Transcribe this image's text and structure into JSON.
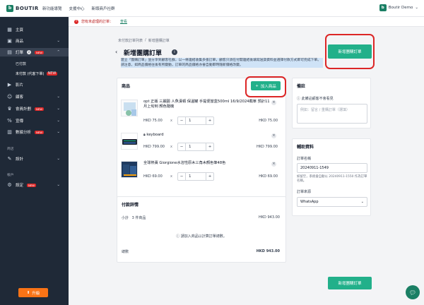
{
  "brand": {
    "name": "BOUTIR",
    "accent": "#22b08a",
    "dark": "#1f2937",
    "alert": "#dc2626"
  },
  "topnav": [
    "新功能導覽",
    "支援中心",
    "新頭商戶社群"
  ],
  "user": {
    "store": "Boutir Demo",
    "chevron": "chevron-down-icon"
  },
  "banner": {
    "message": "您有未處理的訂單：",
    "link": "查看"
  },
  "sidebar": {
    "items": [
      {
        "label": "主頁",
        "icon": "dashboard-icon"
      },
      {
        "label": "商品",
        "icon": "box-icon"
      },
      {
        "label": "訂單",
        "icon": "order-icon",
        "count": "2",
        "badge": "NEW"
      },
      {
        "label": "影片",
        "icon": "play-icon"
      },
      {
        "label": "顧客",
        "icon": "user-icon"
      },
      {
        "label": "會員計劃",
        "icon": "crown-icon",
        "badge": "NEW"
      },
      {
        "label": "宣傳",
        "icon": "percent-icon"
      },
      {
        "label": "數據分析",
        "icon": "chart-icon",
        "badge": "NEW"
      },
      {
        "label": "設計",
        "icon": "design-icon"
      },
      {
        "label": "設定",
        "icon": "gear-icon",
        "badge": "NEW"
      }
    ],
    "order_sub": [
      {
        "label": "已付款"
      },
      {
        "label": "未付款 (代客下單)",
        "badge": "NEW"
      }
    ],
    "sections": {
      "shop": "商店",
      "account": "帳戶"
    },
    "upgrade": "升級"
  },
  "page": {
    "breadcrumb": [
      "未付款訂單列表",
      "/",
      "新增團購訂單"
    ],
    "title": "新增團購訂單",
    "description": "建立「團購訂單」並分享到顧客社群，以一條連結收集多張訂單，顧客只須在付開連結後填寫送貨資料並選擇付款方式即可完成下單。請注意，如商品價格往後有所變動，訂單的商品價格亦會自動即時隨新價格改變。",
    "create_label": "新增團購訂單"
  },
  "products": {
    "title": "商品",
    "add_label": "加入商品",
    "items": [
      {
        "name": "opt 正版 三麗鷗 人魚漢頓 保溫罐 手提便當盒500ml 16/9/2024截單 預計11月上旬到 顏色隨機",
        "price": "HKD 75.00",
        "x": "x",
        "qty": "1",
        "total": "HKD 75.00"
      },
      {
        "name": "keyboard",
        "locked": true,
        "price": "HKD 799.00",
        "x": "x",
        "qty": "1",
        "total": "HKD 799.00"
      },
      {
        "name": "全球熱賣 Giorgione水溶性原木三角木顏色筆48色",
        "price": "HKD 69.00",
        "x": "x",
        "qty": "1",
        "total": "HKD 69.00"
      }
    ]
  },
  "payment": {
    "title": "付款詳情",
    "subtotal_label": "小計",
    "subtotal_count": "3 件商品",
    "subtotal_value": "HKD 943.00",
    "note": "請加入商品以計算訂單總數。",
    "total_label": "總數",
    "total_value": "HKD 943.00"
  },
  "remarks": {
    "title": "備註",
    "hint": "此備註顧客不會看見",
    "placeholder": "例如：留言 / 重購訂單（選填）"
  },
  "aux": {
    "title": "輔助資料",
    "order_name_label": "訂單名稱",
    "order_name_value": "20240911-1549",
    "order_name_hint": "如留空，系統會自動以 20240911-1550 作為訂單名稱。",
    "source_label": "訂單來源",
    "source_value": "WhatsApp"
  }
}
